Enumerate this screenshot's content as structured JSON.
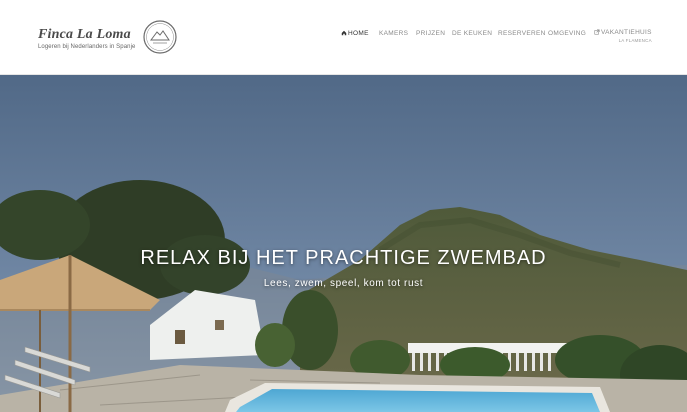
{
  "brand": {
    "name": "Finca La Loma",
    "tagline": "Logeren bij Nederlanders in Spanje",
    "logo_icon": "mountain-seal-icon"
  },
  "nav": {
    "items": [
      {
        "label": "HOME",
        "icon": "home-icon",
        "active": true
      },
      {
        "label": "KAMERS"
      },
      {
        "label": "PRIJZEN"
      },
      {
        "label": "DE KEUKEN"
      },
      {
        "label": "RESERVEREN"
      },
      {
        "label": "OMGEVING"
      },
      {
        "label": "VAKANTIEHUIS",
        "icon": "external-link-icon",
        "sub": "LA FLAMENCA"
      }
    ]
  },
  "hero": {
    "title": "RELAX BIJ HET PRACHTIGE ZWEMBAD",
    "subtitle": "Lees, zwem, speel, kom tot rust"
  },
  "colors": {
    "sky": "#5e7494",
    "pool": "#5fb3d8",
    "text_muted": "#8a8a8a"
  }
}
